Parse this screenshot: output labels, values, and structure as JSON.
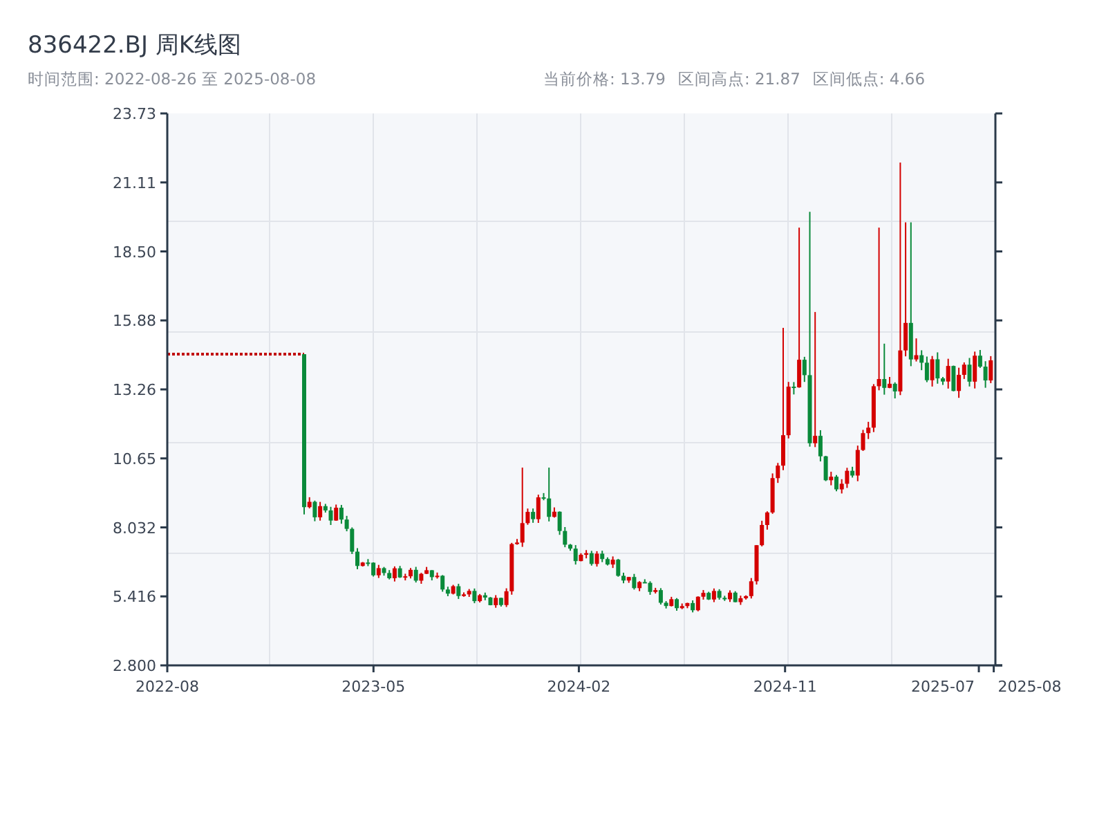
{
  "title": "836422.BJ 周K线图",
  "range": "时间范围: 2022-08-26 至 2025-08-08",
  "stats": [
    "当前价格: 13.79",
    "区间高点: 21.87",
    "区间低点: 4.66"
  ],
  "chart": {
    "y_labels": [
      "23.73",
      "21.11",
      "18.50",
      "15.88",
      "13.26",
      "10.65",
      "8.032",
      "5.416",
      "2.800"
    ],
    "x_labels": [
      "2022-08",
      "2023-05",
      "2024-02",
      "2024-11",
      "2025-07",
      "2025-08"
    ]
  }
}
